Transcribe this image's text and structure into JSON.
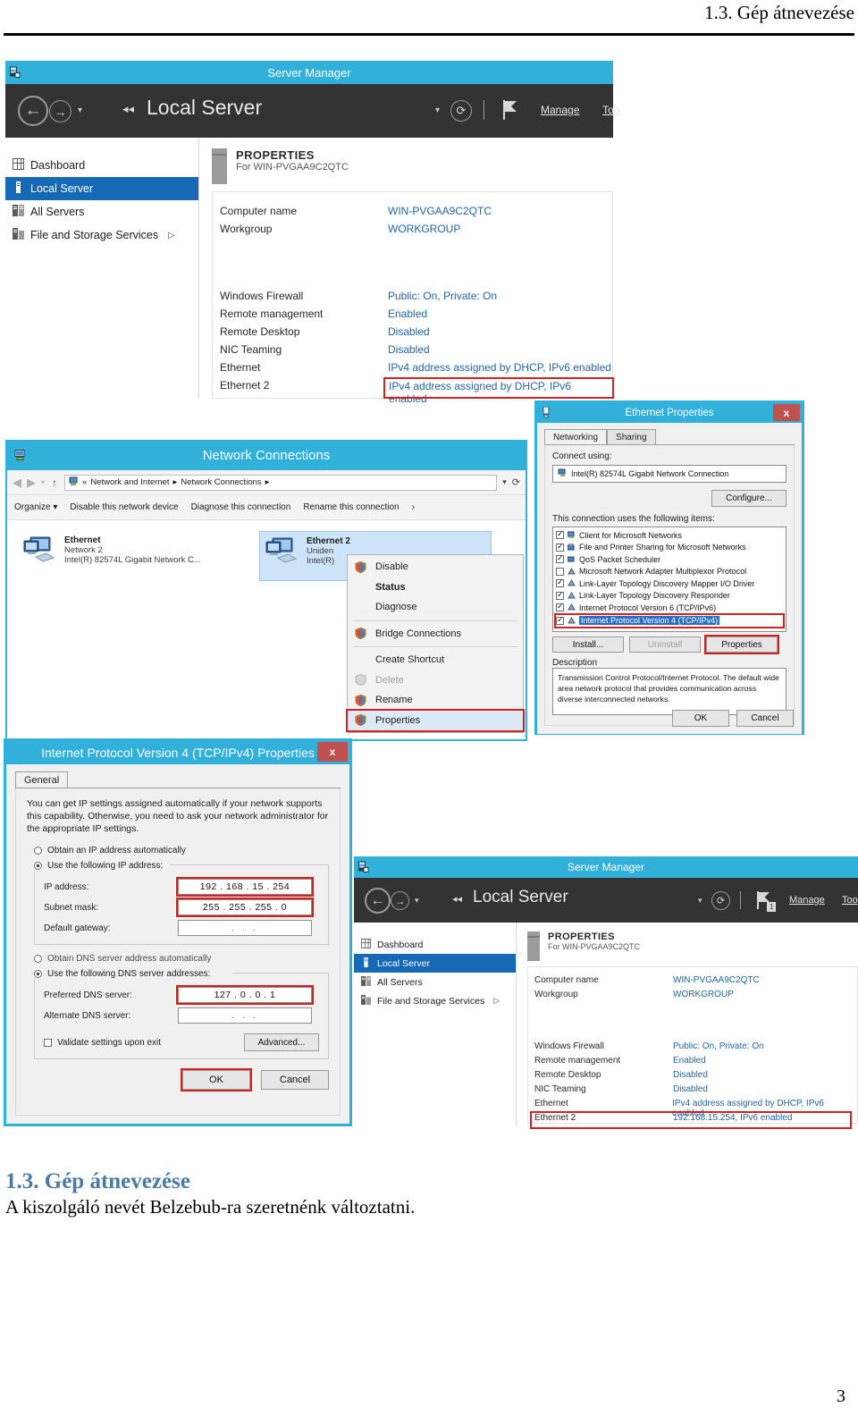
{
  "document": {
    "running_head": "1.3. Gép átnevezése",
    "section_title": "1.3. Gép átnevezése",
    "section_body": "A kiszolgáló nevét Belzebub-ra szeretnénk változtatni.",
    "page_number": "3",
    "accent_color": "#4a7ba7"
  },
  "server_manager_top": {
    "window_icon": "server-manager-icon",
    "title": "Server Manager",
    "nav": {
      "back_icon": "arrow-left-icon",
      "forward_icon": "arrow-right-icon",
      "dropdown_icon": "chevron-down-icon",
      "collapse_icon": "double-chevron-left-icon",
      "breadcrumb": "Local Server",
      "refresh_icon": "refresh-icon",
      "notifications_icon": "flag-icon",
      "notification_count": "",
      "menu_manage": "Manage",
      "menu_tools": "Too"
    },
    "sidebar": {
      "items": [
        {
          "label": "Dashboard",
          "icon": "dashboard-icon",
          "selected": false,
          "chevron": ""
        },
        {
          "label": "Local Server",
          "icon": "server-icon",
          "selected": true,
          "chevron": ""
        },
        {
          "label": "All Servers",
          "icon": "servers-icon",
          "selected": false,
          "chevron": ""
        },
        {
          "label": "File and Storage Services",
          "icon": "storage-icon",
          "selected": false,
          "chevron": "▷"
        }
      ]
    },
    "properties": {
      "heading": "PROPERTIES",
      "subheading": "For WIN-PVGAA9C2QTC",
      "icon": "server-tower-icon",
      "rows_top": [
        {
          "key": "Computer name",
          "value": "WIN-PVGAA9C2QTC",
          "highlight": false
        },
        {
          "key": "Workgroup",
          "value": "WORKGROUP",
          "highlight": false
        }
      ],
      "rows_bottom": [
        {
          "key": "Windows Firewall",
          "value": "Public: On, Private: On",
          "highlight": false
        },
        {
          "key": "Remote management",
          "value": "Enabled",
          "highlight": false
        },
        {
          "key": "Remote Desktop",
          "value": "Disabled",
          "highlight": false
        },
        {
          "key": "NIC Teaming",
          "value": "Disabled",
          "highlight": false
        },
        {
          "key": "Ethernet",
          "value": "IPv4 address assigned by DHCP, IPv6 enabled",
          "highlight": false
        },
        {
          "key": "Ethernet 2",
          "value": "IPv4 address assigned by DHCP, IPv6 enabled",
          "highlight": true
        }
      ]
    }
  },
  "network_connections": {
    "window_icon": "network-connections-icon",
    "title": "Network Connections",
    "address_bar": {
      "back_icon": "back-circle-icon",
      "forward_icon": "forward-circle-icon",
      "recent_icon": "chevron-down-icon",
      "up_icon": "arrow-up-icon",
      "path_icon": "network-icon",
      "path_prefix": "«",
      "crumb1": "Network and Internet",
      "crumb_sep": "▸",
      "crumb2": "Network Connections",
      "crumb_tail": "▸",
      "dropdown_icon": "chevron-down-icon",
      "refresh_icon": "refresh-icon"
    },
    "command_bar": {
      "organize": "Organize",
      "organize_caret": "▾",
      "items": [
        "Disable this network device",
        "Diagnose this connection",
        "Rename this connection"
      ],
      "overflow": "›"
    },
    "connections": [
      {
        "name": "Ethernet",
        "network": "Network 2",
        "adapter": "Intel(R) 82574L Gigabit Network C...",
        "selected": false,
        "icon": "network-adapter-icon"
      },
      {
        "name": "Ethernet 2",
        "network": "Uniden",
        "adapter": "Intel(R)",
        "selected": true,
        "icon": "network-adapter-icon"
      }
    ],
    "context_menu": {
      "items": [
        {
          "label": "Disable",
          "shield": true,
          "bold": false,
          "disabled": false,
          "selected": false,
          "sep_after": false
        },
        {
          "label": "Status",
          "shield": false,
          "bold": true,
          "disabled": false,
          "selected": false,
          "sep_after": false
        },
        {
          "label": "Diagnose",
          "shield": false,
          "bold": false,
          "disabled": false,
          "selected": false,
          "sep_after": true
        },
        {
          "label": "Bridge Connections",
          "shield": true,
          "bold": false,
          "disabled": false,
          "selected": false,
          "sep_after": true
        },
        {
          "label": "Create Shortcut",
          "shield": false,
          "bold": false,
          "disabled": false,
          "selected": false,
          "sep_after": false
        },
        {
          "label": "Delete",
          "shield": true,
          "bold": false,
          "disabled": true,
          "selected": false,
          "sep_after": false
        },
        {
          "label": "Rename",
          "shield": true,
          "bold": false,
          "disabled": false,
          "selected": false,
          "sep_after": false
        },
        {
          "label": "Properties",
          "shield": true,
          "bold": false,
          "disabled": false,
          "selected": true,
          "sep_after": false
        }
      ]
    }
  },
  "ethernet_properties": {
    "title": "Ethernet Properties",
    "window_icon": "adapter-icon",
    "close_label": "x",
    "tabs": [
      {
        "label": "Networking",
        "active": true
      },
      {
        "label": "Sharing",
        "active": false
      }
    ],
    "connect_using_label": "Connect using:",
    "adapter_name": "Intel(R) 82574L Gigabit Network Connection",
    "adapter_icon": "network-adapter-small-icon",
    "configure_button": "Configure...",
    "items_label": "This connection uses the following items:",
    "items": [
      {
        "label": "Client for Microsoft Networks",
        "checked": true,
        "selected": false,
        "icon": "client-icon"
      },
      {
        "label": "File and Printer Sharing for Microsoft Networks",
        "checked": true,
        "selected": false,
        "icon": "sharing-icon"
      },
      {
        "label": "QoS Packet Scheduler",
        "checked": true,
        "selected": false,
        "icon": "qos-icon"
      },
      {
        "label": "Microsoft Network Adapter Multiplexor Protocol",
        "checked": false,
        "selected": false,
        "icon": "protocol-icon"
      },
      {
        "label": "Link-Layer Topology Discovery Mapper I/O Driver",
        "checked": true,
        "selected": false,
        "icon": "protocol-icon"
      },
      {
        "label": "Link-Layer Topology Discovery Responder",
        "checked": true,
        "selected": false,
        "icon": "protocol-icon"
      },
      {
        "label": "Internet Protocol Version 6 (TCP/IPv6)",
        "checked": true,
        "selected": false,
        "icon": "protocol-icon"
      },
      {
        "label": "Internet Protocol Version 4 (TCP/IPv4)",
        "checked": true,
        "selected": true,
        "icon": "protocol-icon"
      }
    ],
    "buttons": {
      "install": "Install...",
      "uninstall": "Uninstall",
      "properties": "Properties"
    },
    "description_label": "Description",
    "description_text": "Transmission Control Protocol/Internet Protocol. The default wide area network protocol that provides communication across diverse interconnected networks.",
    "ok": "OK",
    "cancel": "Cancel"
  },
  "ipv4_properties": {
    "title": "Internet Protocol Version 4 (TCP/IPv4) Properties",
    "close_label": "x",
    "tabs": [
      {
        "label": "General",
        "active": true
      }
    ],
    "intro": "You can get IP settings assigned automatically if your network supports this capability. Otherwise, you need to ask your network administrator for the appropriate IP settings.",
    "radio_auto_ip": {
      "label": "Obtain an IP address automatically",
      "selected": false
    },
    "radio_manual_ip": {
      "label": "Use the following IP address:",
      "selected": true
    },
    "fields": [
      {
        "label": "IP address:",
        "value": "192 . 168 . 15 . 254",
        "highlight": true
      },
      {
        "label": "Subnet mask:",
        "value": "255 . 255 . 255 .  0",
        "highlight": true
      },
      {
        "label": "Default gateway:",
        "value": ".    .    .",
        "highlight": false
      }
    ],
    "radio_auto_dns": {
      "label": "Obtain DNS server address automatically",
      "selected": false
    },
    "radio_manual_dns": {
      "label": "Use the following DNS server addresses:",
      "selected": true
    },
    "dns_fields": [
      {
        "label": "Preferred DNS server:",
        "value": "127 .  0  .  0  .  1",
        "highlight": true
      },
      {
        "label": "Alternate DNS server:",
        "value": ".    .    .",
        "highlight": false
      }
    ],
    "validate_checkbox": {
      "label": "Validate settings upon exit",
      "checked": false
    },
    "advanced_button": "Advanced...",
    "ok": "OK",
    "cancel": "Cancel"
  },
  "server_manager_bottom": {
    "window_icon": "server-manager-icon",
    "title": "Server Manager",
    "nav": {
      "back_icon": "arrow-left-icon",
      "forward_icon": "arrow-right-icon",
      "dropdown_icon": "chevron-down-icon",
      "collapse_icon": "double-chevron-left-icon",
      "breadcrumb": "Local Server",
      "refresh_icon": "refresh-icon",
      "notifications_icon": "flag-icon",
      "notification_count": "1",
      "menu_manage": "Manage",
      "menu_tools": "Too"
    },
    "sidebar": {
      "items": [
        {
          "label": "Dashboard",
          "icon": "dashboard-icon",
          "selected": false,
          "chevron": ""
        },
        {
          "label": "Local Server",
          "icon": "server-icon",
          "selected": true,
          "chevron": ""
        },
        {
          "label": "All Servers",
          "icon": "servers-icon",
          "selected": false,
          "chevron": ""
        },
        {
          "label": "File and Storage Services",
          "icon": "storage-icon",
          "selected": false,
          "chevron": "▷"
        }
      ]
    },
    "properties": {
      "heading": "PROPERTIES",
      "subheading": "For WIN-PVGAA9C2QTC",
      "icon": "server-tower-icon",
      "rows_top": [
        {
          "key": "Computer name",
          "value": "WIN-PVGAA9C2QTC",
          "highlight": false
        },
        {
          "key": "Workgroup",
          "value": "WORKGROUP",
          "highlight": false
        }
      ],
      "rows_bottom": [
        {
          "key": "Windows Firewall",
          "value": "Public: On, Private: On",
          "highlight": false
        },
        {
          "key": "Remote management",
          "value": "Enabled",
          "highlight": false
        },
        {
          "key": "Remote Desktop",
          "value": "Disabled",
          "highlight": false
        },
        {
          "key": "NIC Teaming",
          "value": "Disabled",
          "highlight": false
        },
        {
          "key": "Ethernet",
          "value": "IPv4 address assigned by DHCP, IPv6 enabled",
          "highlight": false
        },
        {
          "key": "Ethernet 2",
          "value": "192.168.15.254, IPv6 enabled",
          "highlight": true
        }
      ]
    }
  }
}
